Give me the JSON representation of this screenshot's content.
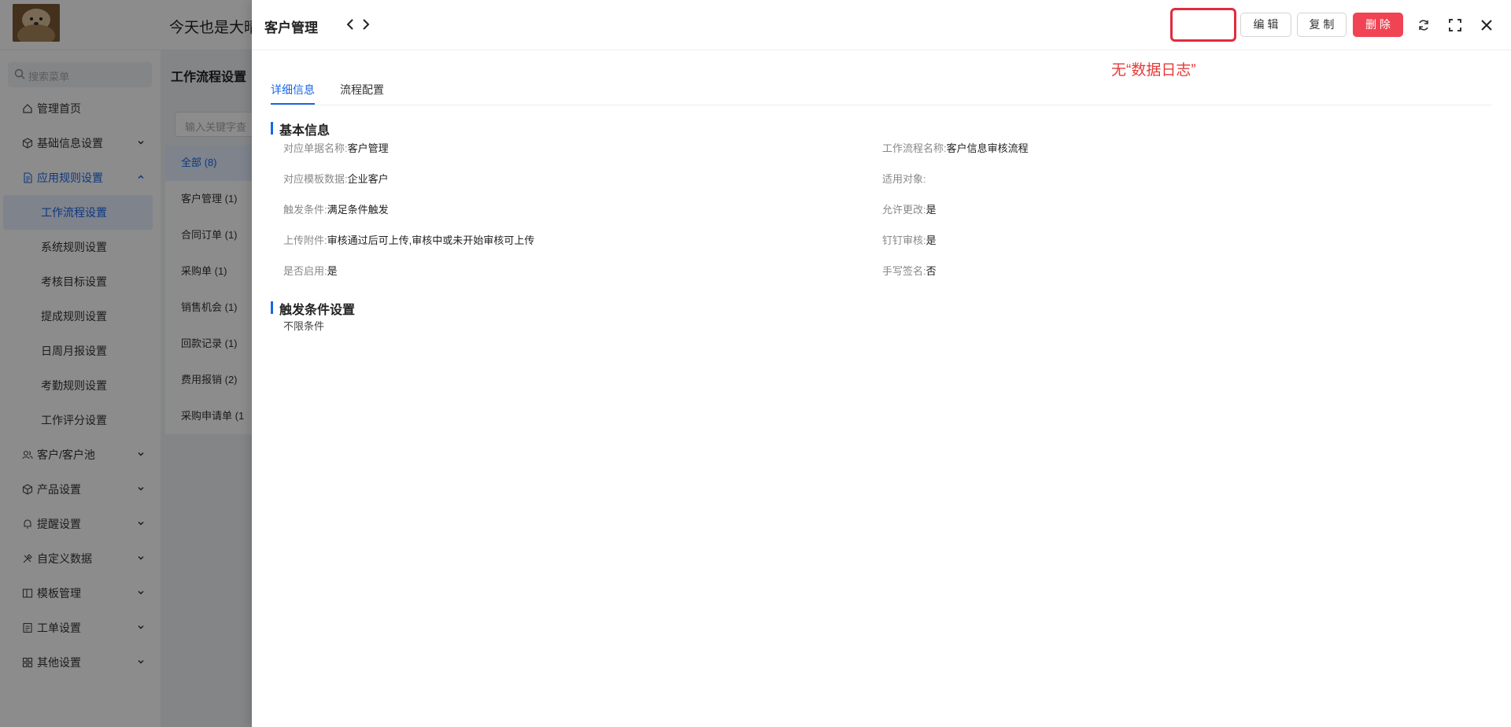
{
  "app": {
    "greeting": "今天也是大晴",
    "sidebar": {
      "search_placeholder": "搜索菜单",
      "items": [
        {
          "label": "管理首页",
          "icon": "home-icon"
        },
        {
          "label": "基础信息设置",
          "icon": "cube-icon"
        },
        {
          "label": "应用规则设置",
          "icon": "document-icon"
        },
        {
          "label": "客户/客户池",
          "icon": "users-icon"
        },
        {
          "label": "产品设置",
          "icon": "cube-icon"
        },
        {
          "label": "提醒设置",
          "icon": "bell-icon"
        },
        {
          "label": "自定义数据",
          "icon": "tools-icon"
        },
        {
          "label": "模板管理",
          "icon": "template-icon"
        },
        {
          "label": "工单设置",
          "icon": "ticket-icon"
        },
        {
          "label": "其他设置",
          "icon": "grid-icon"
        }
      ],
      "sub_items": [
        "工作流程设置",
        "系统规则设置",
        "考核目标设置",
        "提成规则设置",
        "日周月报设置",
        "考勤规则设置",
        "工作评分设置"
      ]
    },
    "content": {
      "title": "工作流程设置",
      "filter_placeholder": "输入关键字查",
      "categories": [
        "全部 (8)",
        "客户管理 (1)",
        "合同订单 (1)",
        "采购单 (1)",
        "销售机会 (1)",
        "回款记录 (1)",
        "费用报销 (2)",
        "采购申请单 (1"
      ]
    }
  },
  "drawer": {
    "title": "客户管理",
    "buttons": {
      "edit": "编 辑",
      "copy": "复 制",
      "delete": "删 除"
    },
    "annotation": "无“数据日志”",
    "tabs": [
      "详细信息",
      "流程配置"
    ],
    "basic_section": "基本信息",
    "fields_left": [
      {
        "label": "对应单据名称:",
        "value": "客户管理"
      },
      {
        "label": "对应模板数据:",
        "value": "企业客户"
      },
      {
        "label": "触发条件:",
        "value": "满足条件触发"
      },
      {
        "label": "上传附件:",
        "value": "审核通过后可上传,审核中或未开始审核可上传"
      },
      {
        "label": "是否启用:",
        "value": "是"
      }
    ],
    "fields_right": [
      {
        "label": "工作流程名称:",
        "value": "客户信息审核流程"
      },
      {
        "label": "适用对象:",
        "value": ""
      },
      {
        "label": "允许更改:",
        "value": "是"
      },
      {
        "label": "钉钉审核:",
        "value": "是"
      },
      {
        "label": "手写签名:",
        "value": "否"
      }
    ],
    "trigger_section": "触发条件设置",
    "trigger_value": "不限条件"
  },
  "colors": {
    "accent": "#1a66e8",
    "danger": "#f04454",
    "annotation_red": "#e53a3a"
  }
}
